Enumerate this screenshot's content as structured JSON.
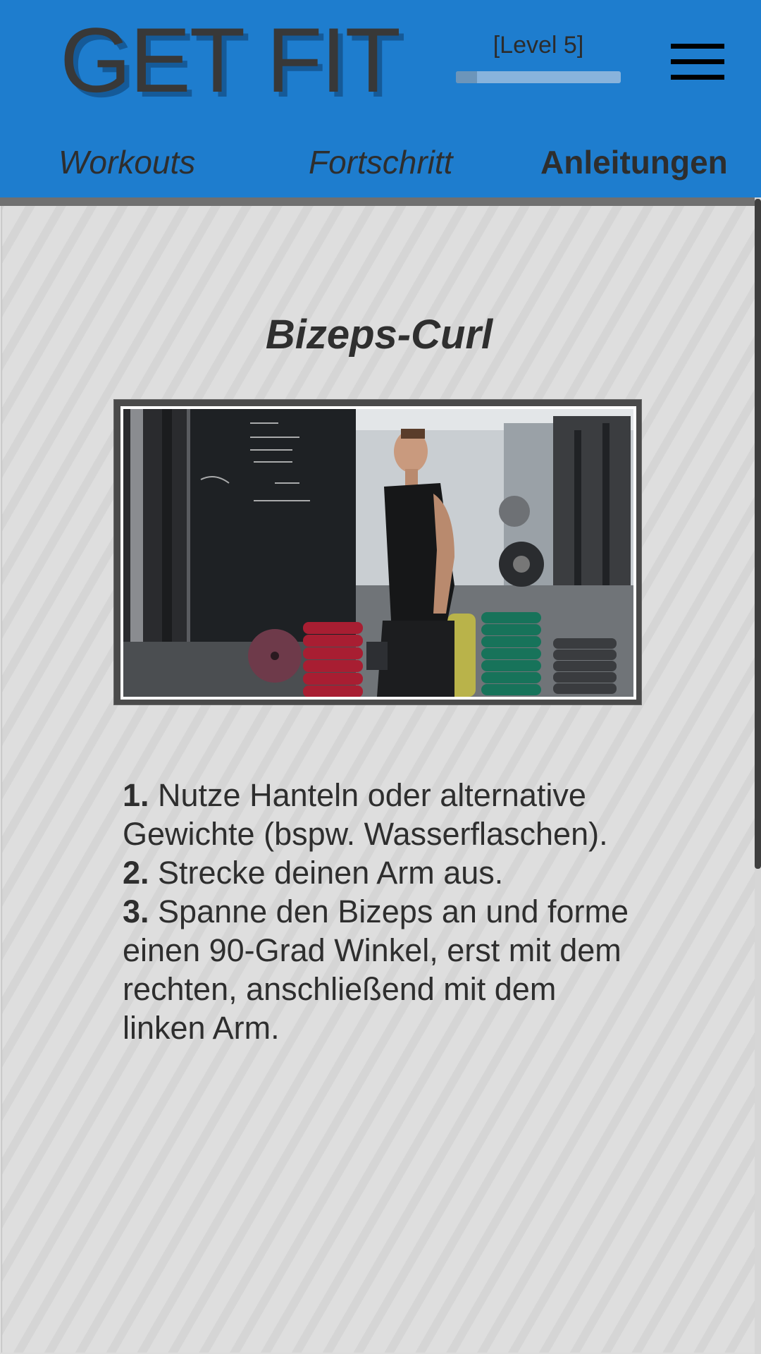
{
  "header": {
    "logo": "GET FIT",
    "level_label": "[Level 5]",
    "level_progress_fraction": 0.13,
    "menu_icon": "hamburger-menu-icon",
    "accent_color": "#1e7dce"
  },
  "nav": {
    "tabs": [
      {
        "label": "Workouts",
        "active": false
      },
      {
        "label": "Fortschritt",
        "active": false
      },
      {
        "label": "Anleitungen",
        "active": true
      }
    ]
  },
  "exercise": {
    "title": "Bizeps-Curl",
    "image": "exercise-video-thumbnail",
    "steps": [
      {
        "number": "1.",
        "text": " Nutze Hanteln oder alternative Gewichte (bspw. Wasserflaschen)."
      },
      {
        "number": "2.",
        "text": " Strecke deinen Arm aus."
      },
      {
        "number": "3.",
        "text": " Spanne den Bizeps an und forme einen 90-Grad Winkel, erst mit dem rechten, anschließend mit dem linken Arm."
      }
    ]
  }
}
